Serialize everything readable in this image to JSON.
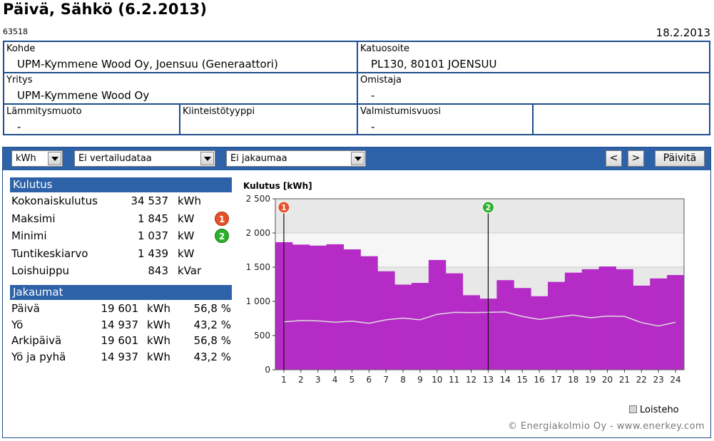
{
  "page": {
    "title": "Päivä, Sähkö (6.2.2013)",
    "id": "63518",
    "date": "18.2.2013"
  },
  "info": {
    "kohde": {
      "label": "Kohde",
      "value": "UPM-Kymmene Wood Oy, Joensuu (Generaattori)"
    },
    "katuosoite": {
      "label": "Katuosoite",
      "value": "PL130, 80101 JOENSUU"
    },
    "yritys": {
      "label": "Yritys",
      "value": "UPM-Kymmene Wood Oy"
    },
    "omistaja": {
      "label": "Omistaja",
      "value": "-"
    },
    "lammitysmuoto": {
      "label": "Lämmitysmuoto",
      "value": "-"
    },
    "kiinteistotyyppi": {
      "label": "Kiinteistötyyppi",
      "value": ""
    },
    "valmistumisvuosi": {
      "label": "Valmistumisvuosi",
      "value": "-"
    }
  },
  "toolbar": {
    "unit": "kWh",
    "comparison": "Ei vertailudataa",
    "distribution": "Ei jakaumaa",
    "prev": "<",
    "next": ">",
    "refresh": "Päivitä"
  },
  "kulutus": {
    "header": "Kulutus",
    "rows": [
      {
        "label": "Kokonaiskulutus",
        "value": "34 537",
        "unit": "kWh",
        "marker": ""
      },
      {
        "label": "Maksimi",
        "value": "1 845",
        "unit": "kW",
        "marker": "1"
      },
      {
        "label": "Minimi",
        "value": "1 037",
        "unit": "kW",
        "marker": "2"
      },
      {
        "label": "Tuntikeskiarvo",
        "value": "1 439",
        "unit": "kW",
        "marker": ""
      },
      {
        "label": "Loishuippu",
        "value": "843",
        "unit": "kVar",
        "marker": ""
      }
    ]
  },
  "jakaumat": {
    "header": "Jakaumat",
    "rows": [
      {
        "label": "Päivä",
        "value": "19 601",
        "unit": "kWh",
        "pct": "56,8 %"
      },
      {
        "label": "Yö",
        "value": "14 937",
        "unit": "kWh",
        "pct": "43,2 %"
      },
      {
        "label": "Arkipäivä",
        "value": "19 601",
        "unit": "kWh",
        "pct": "56,8 %"
      },
      {
        "label": "Yö ja pyhä",
        "value": "14 937",
        "unit": "kWh",
        "pct": "43,2 %"
      }
    ]
  },
  "chart_data": {
    "type": "area",
    "title": "Kulutus [kWh]",
    "xlabel": "",
    "ylabel": "",
    "x": [
      1,
      2,
      3,
      4,
      5,
      6,
      7,
      8,
      9,
      10,
      11,
      12,
      13,
      14,
      15,
      16,
      17,
      18,
      19,
      20,
      21,
      22,
      23,
      24
    ],
    "ylim": [
      0,
      2500
    ],
    "yticks": [
      0,
      500,
      1000,
      1500,
      2000,
      2500
    ],
    "ytick_labels": [
      "0",
      "500",
      "1 000",
      "1 500",
      "2 000",
      "2 500"
    ],
    "grid": true,
    "series": [
      {
        "name": "",
        "style": "step-area",
        "color": "#b52bc6",
        "values": [
          1865,
          1830,
          1815,
          1835,
          1760,
          1660,
          1440,
          1245,
          1270,
          1605,
          1410,
          1090,
          1040,
          1310,
          1195,
          1075,
          1285,
          1420,
          1470,
          1510,
          1470,
          1230,
          1335,
          1385
        ]
      },
      {
        "name": "Loisteho",
        "style": "line",
        "color": "#dcdcdc",
        "values": [
          700,
          720,
          715,
          695,
          710,
          680,
          730,
          755,
          730,
          810,
          840,
          835,
          840,
          845,
          780,
          735,
          770,
          800,
          760,
          785,
          780,
          690,
          640,
          695
        ]
      }
    ],
    "markers": [
      {
        "label": "1",
        "x": 1,
        "color": "#e8502c"
      },
      {
        "label": "2",
        "x": 13,
        "color": "#2cb02c"
      }
    ],
    "legend": {
      "position": "bottom-right",
      "entries": [
        "Loisteho"
      ]
    },
    "copyright": "© Energiakolmio Oy - www.enerkey.com"
  }
}
